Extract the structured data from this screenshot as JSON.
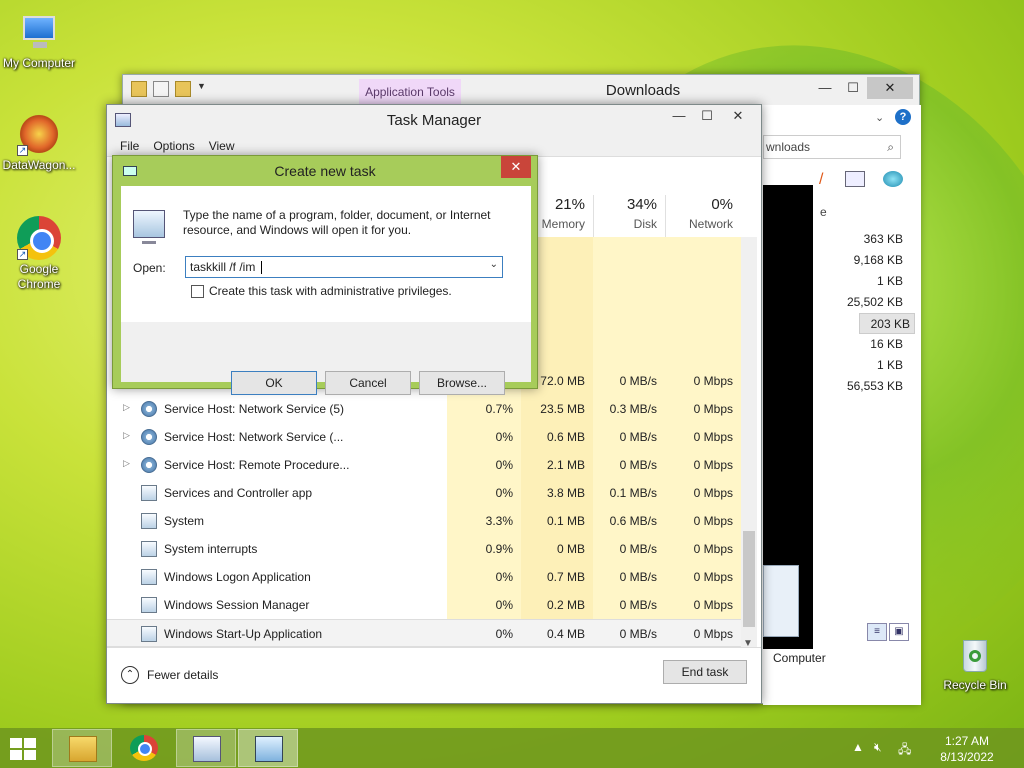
{
  "desktop": {
    "icons": [
      {
        "label": "My Computer",
        "icon": "computer-icon"
      },
      {
        "label": "DataWagon...",
        "icon": "datawagon-icon"
      },
      {
        "label": "Google Chrome",
        "icon": "chrome-icon"
      },
      {
        "label": "Recycle Bin",
        "icon": "recycle-bin-icon"
      }
    ]
  },
  "explorer": {
    "title": "Downloads",
    "contextual_tab": "Application Tools",
    "address_partial": "wnloads",
    "column_partial": "e",
    "sizes": [
      "363 KB",
      "9,168 KB",
      "1 KB",
      "25,502 KB",
      "203 KB",
      "16 KB",
      "1 KB",
      "56,553 KB"
    ],
    "selected_size_index": 4,
    "nav_partial": "Computer"
  },
  "taskmgr": {
    "title": "Task Manager",
    "menu": [
      "File",
      "Options",
      "View"
    ],
    "columns": {
      "memory": {
        "pct": "21%",
        "label": "Memory"
      },
      "disk": {
        "pct": "34%",
        "label": "Disk"
      },
      "network": {
        "pct": "0%",
        "label": "Network"
      }
    },
    "partial_row": {
      "mem": "72.0 MB",
      "disk": "0 MB/s",
      "net": "0 Mbps"
    },
    "rows": [
      {
        "name": "Service Host: Network Service (5)",
        "cpu": "0.7%",
        "mem": "23.5 MB",
        "disk": "0.3 MB/s",
        "net": "0 Mbps",
        "expandable": true,
        "icon": "gear"
      },
      {
        "name": "Service Host: Network Service (...",
        "cpu": "0%",
        "mem": "0.6 MB",
        "disk": "0 MB/s",
        "net": "0 Mbps",
        "expandable": true,
        "icon": "gear"
      },
      {
        "name": "Service Host: Remote Procedure...",
        "cpu": "0%",
        "mem": "2.1 MB",
        "disk": "0 MB/s",
        "net": "0 Mbps",
        "expandable": true,
        "icon": "gear"
      },
      {
        "name": "Services and Controller app",
        "cpu": "0%",
        "mem": "3.8 MB",
        "disk": "0.1 MB/s",
        "net": "0 Mbps",
        "expandable": false,
        "icon": "app"
      },
      {
        "name": "System",
        "cpu": "3.3%",
        "mem": "0.1 MB",
        "disk": "0.6 MB/s",
        "net": "0 Mbps",
        "expandable": false,
        "icon": "app"
      },
      {
        "name": "System interrupts",
        "cpu": "0.9%",
        "mem": "0 MB",
        "disk": "0 MB/s",
        "net": "0 Mbps",
        "expandable": false,
        "icon": "app"
      },
      {
        "name": "Windows Logon Application",
        "cpu": "0%",
        "mem": "0.7 MB",
        "disk": "0 MB/s",
        "net": "0 Mbps",
        "expandable": false,
        "icon": "app"
      },
      {
        "name": "Windows Session Manager",
        "cpu": "0%",
        "mem": "0.2 MB",
        "disk": "0 MB/s",
        "net": "0 Mbps",
        "expandable": false,
        "icon": "app"
      },
      {
        "name": "Windows Start-Up Application",
        "cpu": "0%",
        "mem": "0.4 MB",
        "disk": "0 MB/s",
        "net": "0 Mbps",
        "expandable": false,
        "icon": "app"
      }
    ],
    "selected_row_index": 8,
    "fewer_details": "Fewer details",
    "end_task": "End task"
  },
  "dialog": {
    "title": "Create new task",
    "message": "Type the name of a program, folder, document, or Internet resource, and Windows will open it for you.",
    "open_label": "Open:",
    "open_value": "taskkill /f /im ",
    "admin_label": "Create this task with administrative privileges.",
    "admin_checked": false,
    "ok": "OK",
    "cancel": "Cancel",
    "browse": "Browse..."
  },
  "taskbar": {
    "time": "1:27 AM",
    "date": "8/13/2022",
    "apps": [
      "file-explorer-icon",
      "chrome-icon",
      "task-manager-icon",
      "run-icon"
    ],
    "active_app_index": 3
  },
  "colors": {
    "dialog_frame": "#a7cc5a",
    "heatmap": "#fff6c8",
    "close_red": "#c9453a"
  }
}
